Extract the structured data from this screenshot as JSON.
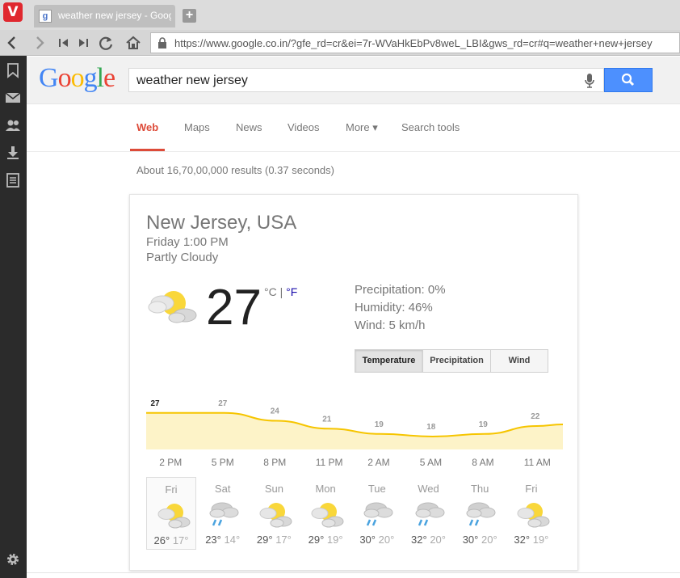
{
  "browser": {
    "tab_title": "weather new jersey - Google",
    "url": "https://www.google.co.in/?gfe_rd=cr&ei=7r-WVaHkEbPv8weL_LBI&gws_rd=cr#q=weather+new+jersey",
    "logo_letter": "V"
  },
  "search": {
    "query": "weather new jersey",
    "logo": [
      "G",
      "o",
      "o",
      "g",
      "l",
      "e"
    ]
  },
  "nav_tabs": [
    "Web",
    "Maps",
    "News",
    "Videos",
    "More ▾",
    "Search tools"
  ],
  "stats": "About 16,70,00,000 results (0.37 seconds)",
  "weather": {
    "location": "New Jersey, USA",
    "datetime": "Friday 1:00 PM",
    "condition": "Partly Cloudy",
    "temperature": "27",
    "unit_c": "°C",
    "unit_sep": " | ",
    "unit_f": "°F",
    "precipitation": "Precipitation: 0%",
    "humidity": "Humidity: 46%",
    "wind": "Wind: 5 km/h",
    "segments": [
      "Temperature",
      "Precipitation",
      "Wind"
    ],
    "selected_segment": "Temperature",
    "time_labels": [
      "2 PM",
      "5 PM",
      "8 PM",
      "11 PM",
      "2 AM",
      "5 AM",
      "8 AM",
      "11 AM"
    ],
    "forecast": [
      {
        "day": "Fri",
        "hi": "26°",
        "lo": "17°",
        "icon": "partly-cloudy-icon"
      },
      {
        "day": "Sat",
        "hi": "23°",
        "lo": "14°",
        "icon": "rain-icon"
      },
      {
        "day": "Sun",
        "hi": "29°",
        "lo": "17°",
        "icon": "partly-cloudy-icon"
      },
      {
        "day": "Mon",
        "hi": "29°",
        "lo": "19°",
        "icon": "partly-cloudy-icon"
      },
      {
        "day": "Tue",
        "hi": "30°",
        "lo": "20°",
        "icon": "rain-icon"
      },
      {
        "day": "Wed",
        "hi": "32°",
        "lo": "20°",
        "icon": "rain-icon"
      },
      {
        "day": "Thu",
        "hi": "30°",
        "lo": "20°",
        "icon": "rain-icon"
      },
      {
        "day": "Fri",
        "hi": "32°",
        "lo": "19°",
        "icon": "partly-cloudy-icon"
      }
    ]
  },
  "chart_data": {
    "type": "area",
    "x": [
      "2 PM",
      "5 PM",
      "8 PM",
      "11 PM",
      "2 AM",
      "5 AM",
      "8 AM",
      "11 AM"
    ],
    "values": [
      27,
      27,
      24,
      21,
      19,
      18,
      19,
      22
    ],
    "labels": [
      "27",
      "27",
      "24",
      "21",
      "19",
      "18",
      "19",
      "22"
    ],
    "ylim": [
      14,
      30
    ]
  },
  "colors": {
    "accent_red": "#dd4b39",
    "search_blue": "#4d90fe",
    "chart_line": "#f6c500",
    "chart_fill": "#fdf3c8",
    "sun": "#f9d73a"
  }
}
